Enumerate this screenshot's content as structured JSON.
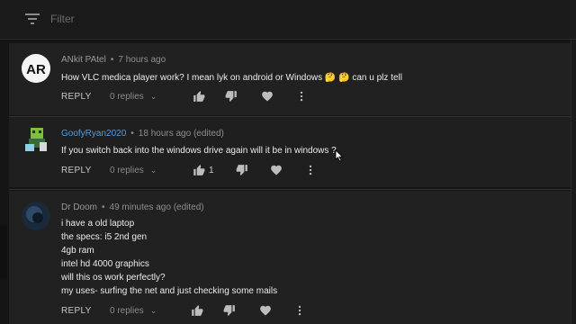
{
  "filter": {
    "placeholder": "Filter"
  },
  "comments": [
    {
      "author": "ANkit PAtel",
      "time": "7 hours ago",
      "edited": "",
      "lines": [
        "How VLC medica player work? I mean lyk on android or Windows 🤔 🤔  can u plz tell"
      ],
      "reply_label": "REPLY",
      "replies_label": "0 replies",
      "likes": "",
      "avatar_text": "AR"
    },
    {
      "author": "GoofyRyan2020",
      "time": "18 hours ago",
      "edited": "(edited)",
      "lines": [
        "If you switch back into the windows drive again will it be in windows ?"
      ],
      "reply_label": "REPLY",
      "replies_label": "0 replies",
      "likes": "1",
      "avatar_text": ""
    },
    {
      "author": "Dr Doom",
      "time": "49 minutes ago",
      "edited": "(edited)",
      "lines": [
        "i have a old laptop",
        "the specs: i5 2nd gen",
        "4gb ram",
        "intel hd 4000 graphics",
        "will this os work perfectly?",
        "my uses-  surfing the net and just checking some mails"
      ],
      "reply_label": "REPLY",
      "replies_label": "0 replies",
      "likes": "",
      "avatar_text": ""
    }
  ],
  "icons": {
    "filter": "filter-icon",
    "like": "thumbs-up-icon",
    "dislike": "thumbs-down-icon",
    "heart": "heart-icon",
    "more": "more-vertical-icon",
    "chevron": "chevron-down-icon"
  },
  "colors": {
    "background": "#151515",
    "card": "#212121",
    "link": "#5a9bd8"
  }
}
